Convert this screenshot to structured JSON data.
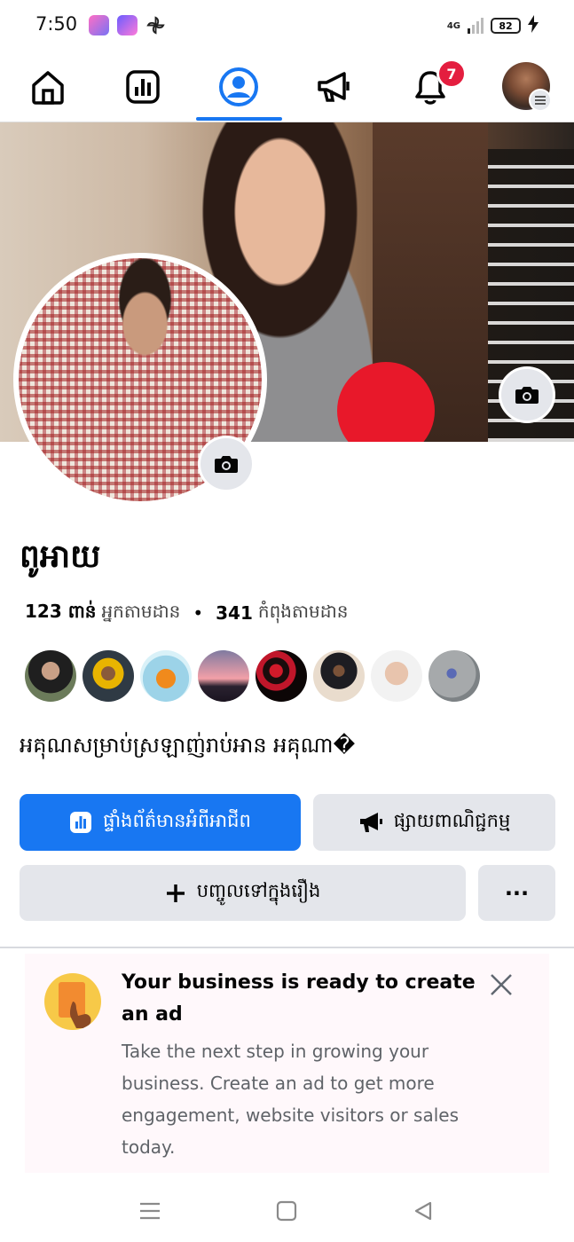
{
  "status_bar": {
    "time": "7:50",
    "network": "4G",
    "battery": "82",
    "app_icons": [
      "app-icon-pink",
      "app-icon-purple",
      "app-icon-pinwheel"
    ]
  },
  "top_nav": {
    "tabs": [
      {
        "icon": "home-icon"
      },
      {
        "icon": "dashboard-icon"
      },
      {
        "icon": "profile-icon",
        "active": true
      },
      {
        "icon": "megaphone-icon"
      },
      {
        "icon": "bell-icon"
      }
    ],
    "notification_count": "7",
    "accent": "#1877f2"
  },
  "profile": {
    "name": "ពូអាយ",
    "followers_count": "123 ពាន់",
    "followers_label": "អ្នកតាមដាន",
    "following_count": "341",
    "following_label": "កំពុងតាមដាន",
    "bio": "អគុណសម្រាប់ស្រឡាញ់រាប់អាន អគុណា�"
  },
  "buttons": {
    "dashboard": "ផ្ទាំងព័ត៌មានអំពីអាជីព",
    "ads": "ផ្សាយពាណិជ្ជកម្ម",
    "add_story": "បញ្ចូលទៅក្នុងរឿង",
    "more": "···"
  },
  "business_card": {
    "title": "Your business is ready to create an ad",
    "description": "Take the next step in growing your business. Create an ad to get more engagement, website visitors or sales today."
  }
}
